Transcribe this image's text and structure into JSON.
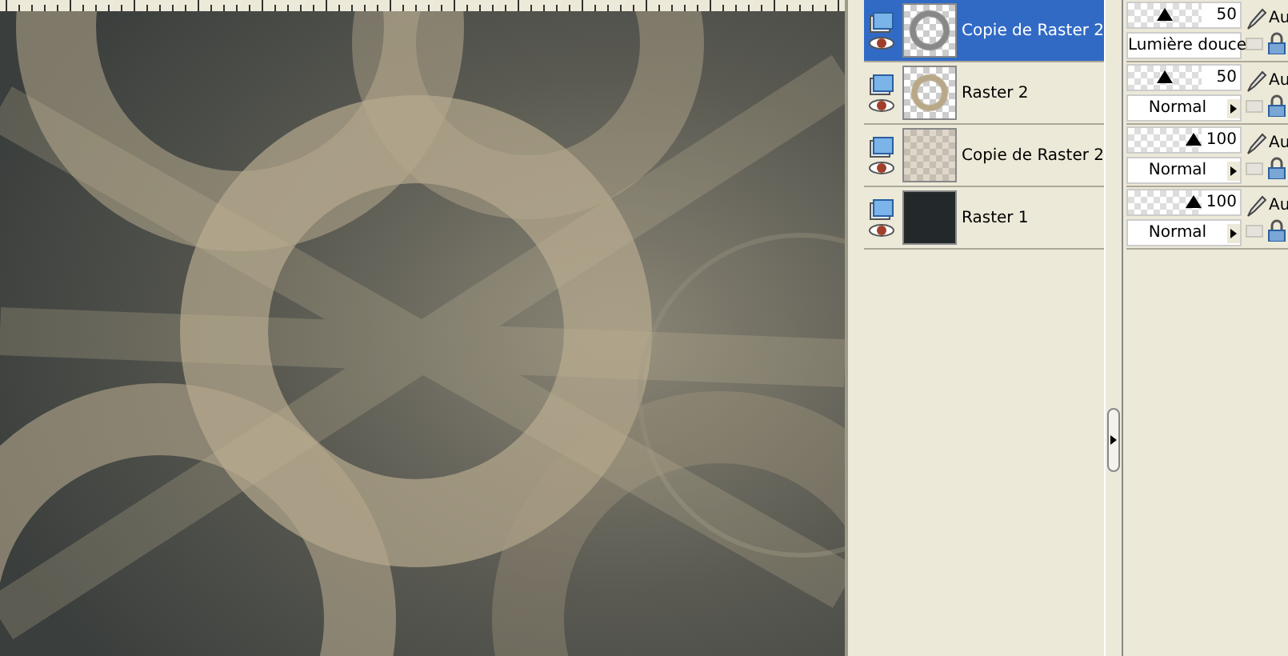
{
  "layers": [
    {
      "name": "Copie de Raster 2",
      "selected": true,
      "kind": "grey-pattern",
      "opacity": "50",
      "level": 0.5,
      "blend_mode": "Lumière douce",
      "link_label": "Au"
    },
    {
      "name": "Raster 2",
      "selected": false,
      "kind": "tan-pattern",
      "opacity": "50",
      "level": 0.5,
      "blend_mode": "Normal",
      "link_label": "Au"
    },
    {
      "name": "Copie de Raster 2",
      "selected": false,
      "kind": "faint-pattern",
      "opacity": "100",
      "level": 1,
      "blend_mode": "Normal",
      "link_label": "Au"
    },
    {
      "name": "Raster 1",
      "selected": false,
      "kind": "solid",
      "opacity": "100",
      "level": 1,
      "blend_mode": "Normal",
      "link_label": "Au"
    }
  ]
}
